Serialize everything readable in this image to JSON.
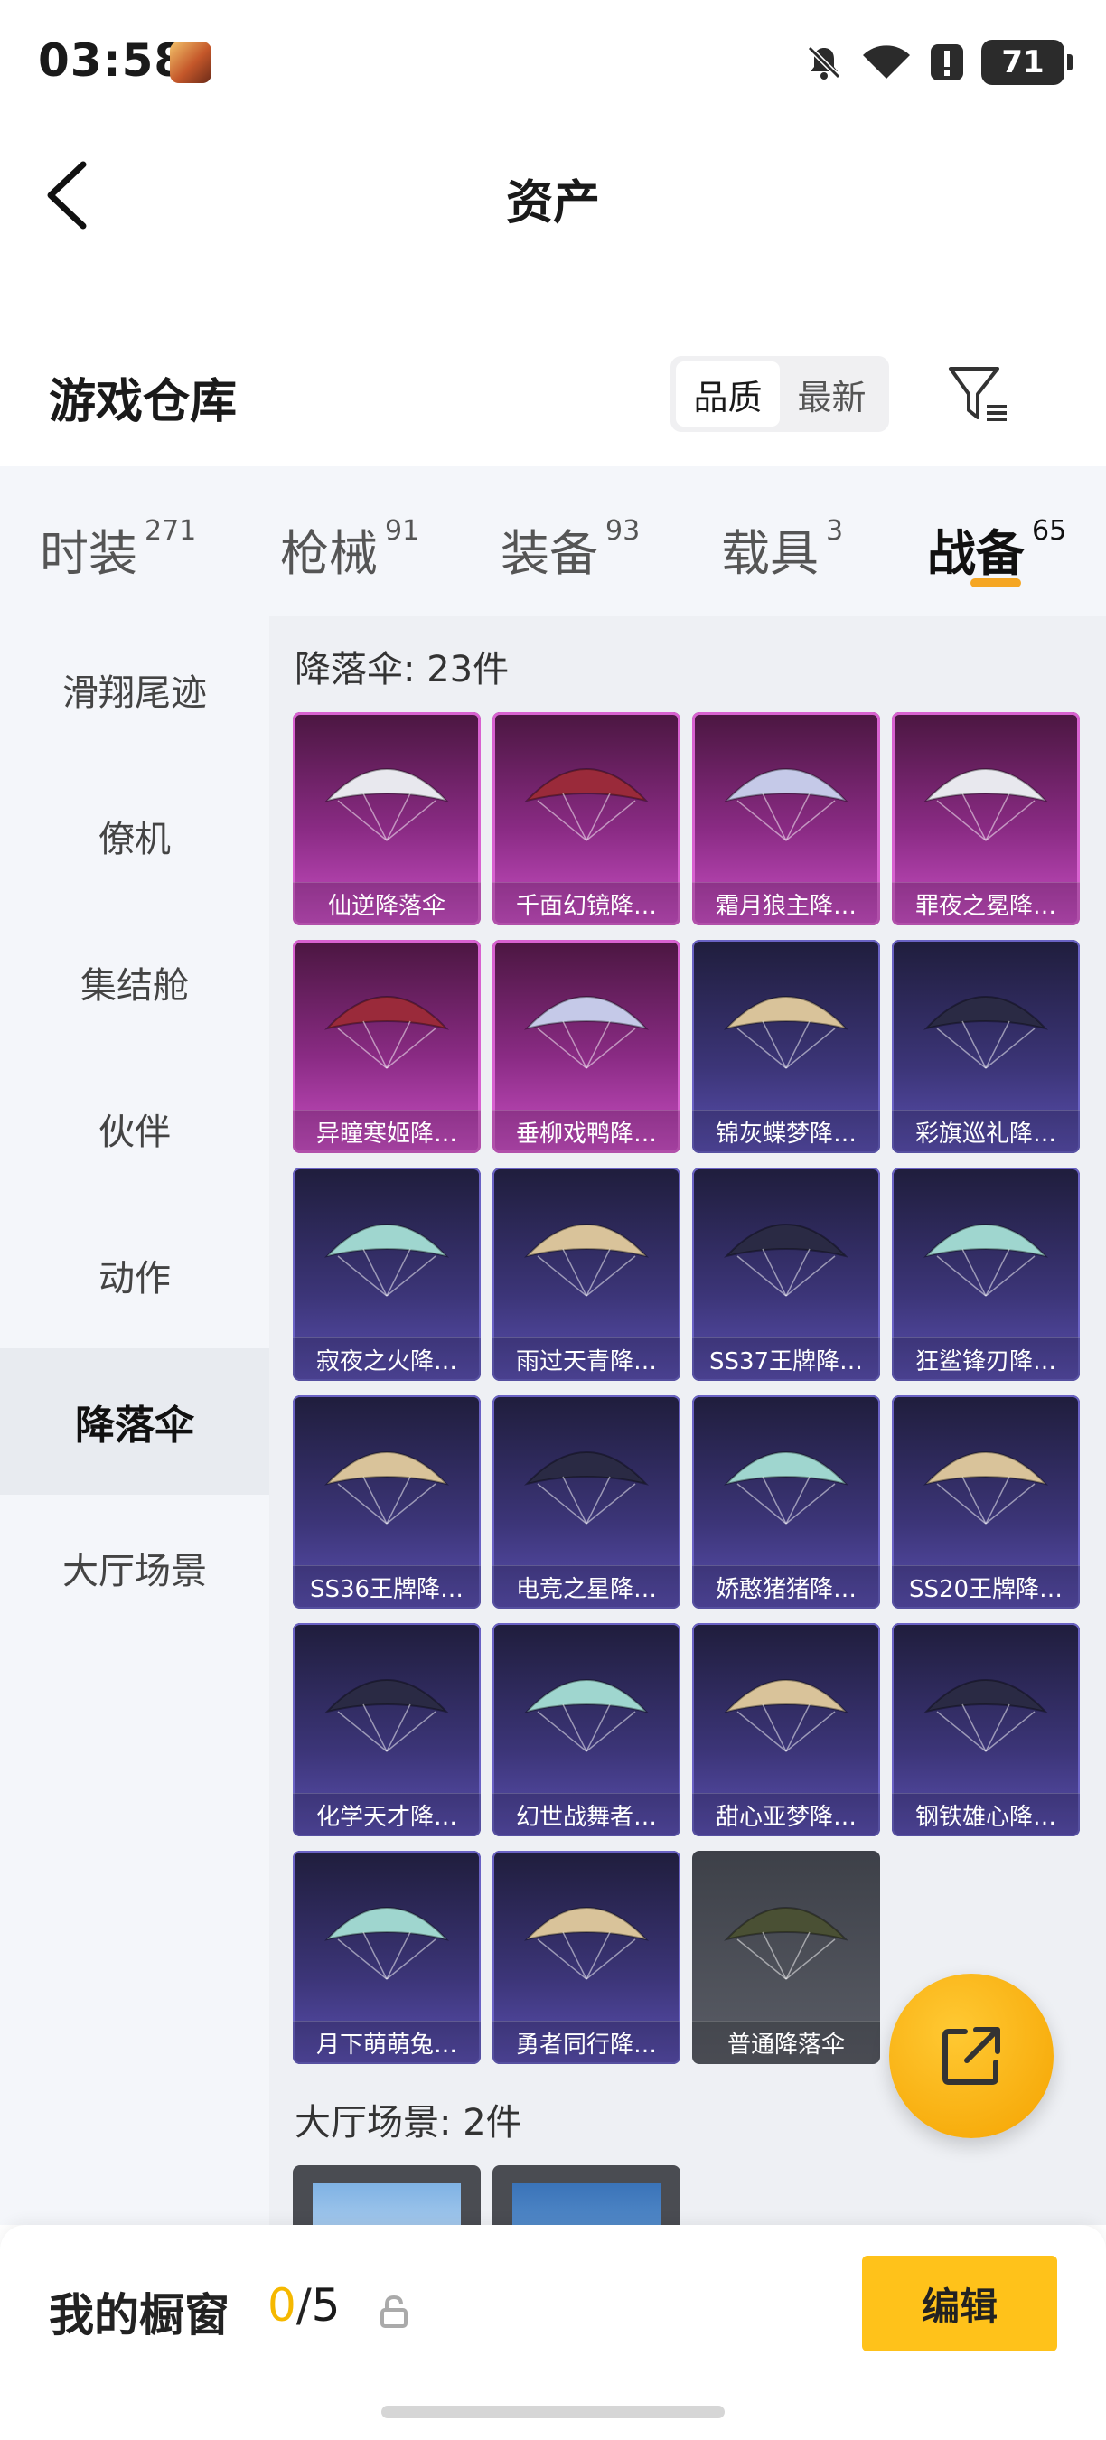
{
  "status": {
    "time": "03:58",
    "battery": "71",
    "icons": [
      "mute-bell-icon",
      "wifi-icon",
      "alert-icon",
      "battery-icon"
    ]
  },
  "nav": {
    "title": "资产",
    "back_icon": "chevron-left-icon"
  },
  "warehouse": {
    "title": "游戏仓库",
    "sort_options": [
      "品质",
      "最新"
    ],
    "selected_sort": "品质",
    "filter_icon": "filter-icon"
  },
  "tabs": [
    {
      "label": "时装",
      "count": "271"
    },
    {
      "label": "枪械",
      "count": "91"
    },
    {
      "label": "装备",
      "count": "93"
    },
    {
      "label": "载具",
      "count": "3"
    },
    {
      "label": "战备",
      "count": "65"
    }
  ],
  "active_tab": "战备",
  "sidebar": {
    "items": [
      "滑翔尾迹",
      "僚机",
      "集结舱",
      "伙伴",
      "动作",
      "降落伞",
      "大厅场景"
    ],
    "active": "降落伞"
  },
  "sections": {
    "parachute": {
      "header": "降落伞: 23件",
      "items": [
        {
          "name": "仙逆降落伞",
          "rarity": "pink"
        },
        {
          "name": "千面幻镜降…",
          "rarity": "pink"
        },
        {
          "name": "霜月狼主降…",
          "rarity": "pink"
        },
        {
          "name": "罪夜之冕降…",
          "rarity": "pink"
        },
        {
          "name": "异瞳寒姬降…",
          "rarity": "pink"
        },
        {
          "name": "垂柳戏鸭降…",
          "rarity": "pink"
        },
        {
          "name": "锦灰蝶梦降…",
          "rarity": "purple"
        },
        {
          "name": "彩旗巡礼降…",
          "rarity": "purple"
        },
        {
          "name": "寂夜之火降…",
          "rarity": "purple"
        },
        {
          "name": "雨过天青降…",
          "rarity": "purple"
        },
        {
          "name": "SS37王牌降…",
          "rarity": "purple"
        },
        {
          "name": "狂鲨锋刃降…",
          "rarity": "purple"
        },
        {
          "name": "SS36王牌降…",
          "rarity": "purple"
        },
        {
          "name": "电竞之星降…",
          "rarity": "purple"
        },
        {
          "name": "娇憨猪猪降…",
          "rarity": "purple"
        },
        {
          "name": "SS20王牌降…",
          "rarity": "purple"
        },
        {
          "name": "化学天才降…",
          "rarity": "purple"
        },
        {
          "name": "幻世战舞者…",
          "rarity": "purple"
        },
        {
          "name": "甜心亚梦降…",
          "rarity": "purple"
        },
        {
          "name": "钢铁雄心降…",
          "rarity": "purple"
        },
        {
          "name": "月下萌萌兔…",
          "rarity": "purple"
        },
        {
          "name": "勇者同行降…",
          "rarity": "purple"
        },
        {
          "name": "普通降落伞",
          "rarity": "gray"
        }
      ]
    },
    "lobby": {
      "header": "大厅场景: 2件"
    }
  },
  "fab": {
    "icon": "share-external-icon"
  },
  "showcase": {
    "title": "我的橱窗",
    "current": "0",
    "separator": "/",
    "max": "5",
    "lock_icon": "lock-icon",
    "edit_label": "编辑"
  },
  "colors": {
    "accent": "#f5a623",
    "button_yellow": "#ffc21a",
    "rarity_pink": "#c94fc4",
    "rarity_purple": "#5a4fb0",
    "rarity_gray": "#5a5d66"
  }
}
